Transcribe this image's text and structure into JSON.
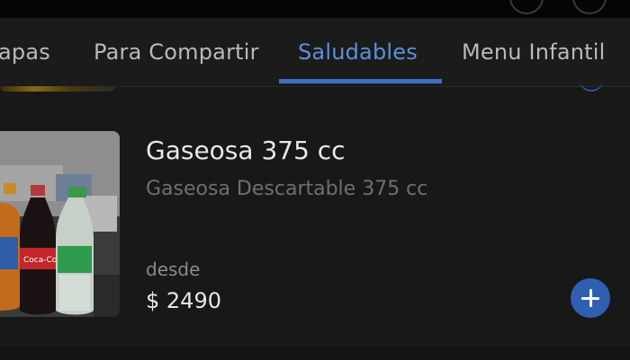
{
  "tabs": [
    {
      "label": "apas",
      "active": false
    },
    {
      "label": "Para Compartir",
      "active": false
    },
    {
      "label": "Saludables",
      "active": true
    },
    {
      "label": "Menu Infantil",
      "active": false
    }
  ],
  "product": {
    "title": "Gaseosa 375 cc",
    "description": "Gaseosa Descartable 375 cc",
    "price_prefix": "desde",
    "price": "$ 2490",
    "image_icon": "soda-bottles-image",
    "add_icon": "plus-icon"
  },
  "colors": {
    "background": "#181818",
    "accent": "#3f6fc1",
    "accent_text": "#5f8fd7",
    "add_button": "#2f5fb0"
  }
}
